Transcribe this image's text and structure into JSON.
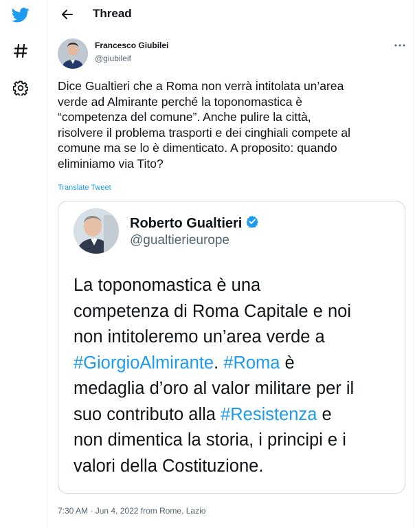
{
  "sidebar": {
    "icons": [
      "twitter-bird-icon",
      "hashtag-icon",
      "gear-icon"
    ],
    "brand_color": "#1d9bf0"
  },
  "header": {
    "title": "Thread"
  },
  "tweet": {
    "author_name": "Francesco Giubilei",
    "author_handle": "@giubileif",
    "text_lines": [
      "Dice Gualtieri che a Roma non verrà intitolata un’area",
      "verde ad Almirante perché la toponomastica è",
      "“competenza del comune”. Anche pulire la città,",
      "risolvere il problema trasporti e dei cinghiali compete al",
      "comune ma se lo è dimenticato. A proposito: quando",
      "eliminiamo via Tito?"
    ],
    "translate_label": "Translate Tweet",
    "meta": "7:30 AM · Jun 4, 2022 from Rome, Lazio"
  },
  "quote": {
    "author_name": "Roberto Gualtieri",
    "verified": true,
    "author_handle": "@gualtierieurope",
    "line1": "La toponomastica è una",
    "line2": "competenza di Roma Capitale e noi",
    "line3": "non intitoleremo un’area verde a",
    "line4_hashtag1": "#GiorgioAlmirante",
    "line4_sep": ". ",
    "line4_hashtag2": "#Roma",
    "line4_tail": " è",
    "line5": "medaglia d’oro al valor militare per il",
    "line6_pre": "suo contributo alla ",
    "line6_hashtag": "#Resistenza",
    "line6_tail": " e",
    "line7": "non dimentica la storia, i principi e i",
    "line8": "valori della Costituzione."
  },
  "colors": {
    "link": "#1d9bf0",
    "text": "#0f1419",
    "muted": "#536471",
    "border": "#cfd9de"
  }
}
